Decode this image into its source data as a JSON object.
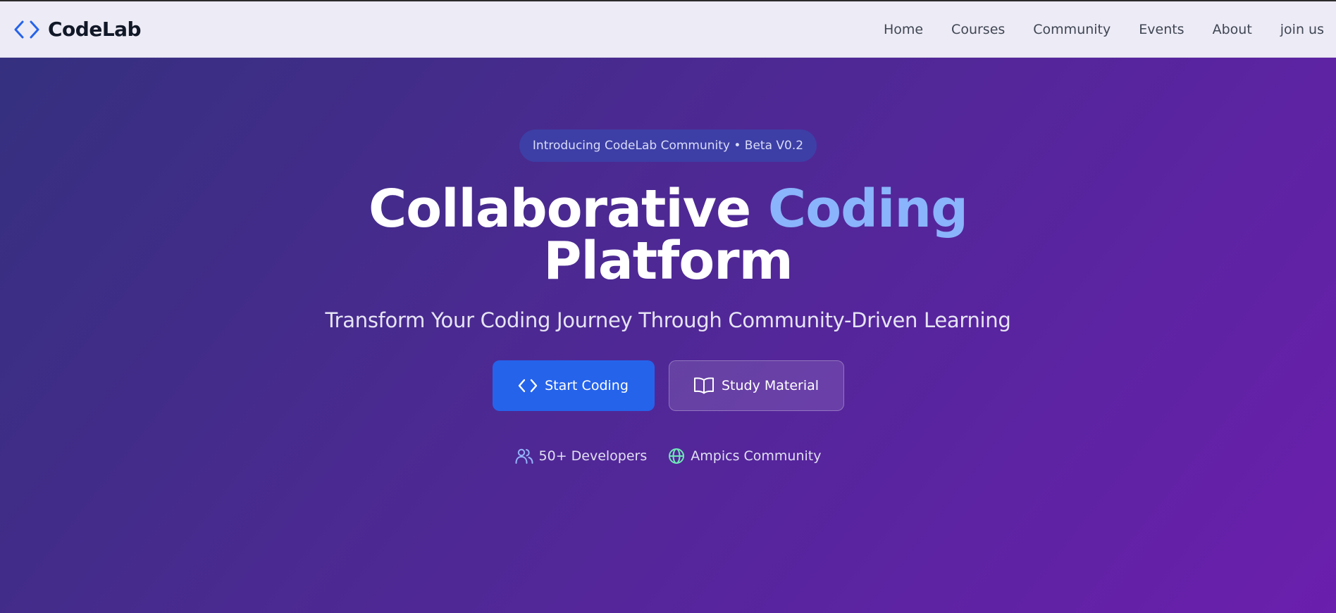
{
  "brand": {
    "name": "CodeLab",
    "icon": "code-brackets-icon",
    "icon_color": "#2563eb"
  },
  "nav": {
    "items": [
      {
        "label": "Home"
      },
      {
        "label": "Courses"
      },
      {
        "label": "Community"
      },
      {
        "label": "Events"
      },
      {
        "label": "About"
      },
      {
        "label": "join us"
      }
    ]
  },
  "hero": {
    "badge": "Introducing CodeLab Community • Beta V0.2",
    "headline_part1": "Collaborative",
    "headline_accent": "Coding",
    "headline_line2": "Platform",
    "subtitle": "Transform Your Coding Journey Through Community-Driven Learning",
    "primary_button": {
      "label": "Start Coding",
      "icon": "code-brackets-icon"
    },
    "secondary_button": {
      "label": "Study Material",
      "icon": "open-book-icon"
    },
    "stats": [
      {
        "label": "50+ Developers",
        "icon": "users-icon",
        "icon_color": "#93b4fb"
      },
      {
        "label": "Ampics Community",
        "icon": "globe-icon",
        "icon_color": "#6ee7b7"
      }
    ]
  },
  "colors": {
    "accent": "#8ab4fb",
    "primary_button": "#2563eb",
    "hero_gradient_start": "#35307f",
    "hero_gradient_end": "#6b1fad",
    "navbar_background": "#edebf5"
  }
}
